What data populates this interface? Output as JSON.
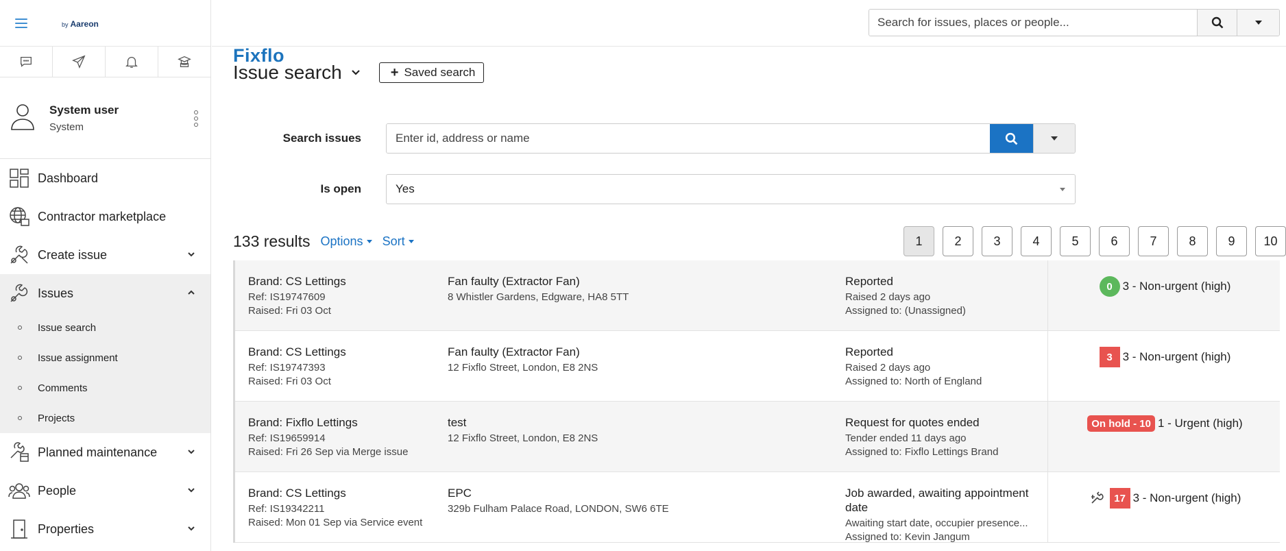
{
  "app": {
    "logo_text": "Fixflo",
    "logo_by": "by",
    "logo_company": "Aareon"
  },
  "colors": {
    "accent": "#1b73c4",
    "green_badge": "#5cb85c",
    "red_badge": "#e8534f"
  },
  "sidebar": {
    "icon_tabs": [
      {
        "icon": "chat-icon"
      },
      {
        "icon": "send-icon"
      },
      {
        "icon": "bell-icon"
      },
      {
        "icon": "graduation-icon"
      }
    ],
    "user": {
      "name": "System user",
      "role": "System"
    },
    "nav": [
      {
        "label": "Dashboard",
        "icon": "dashboard-icon"
      },
      {
        "label": "Contractor marketplace",
        "icon": "globe-icon"
      },
      {
        "label": "Create issue",
        "icon": "wrench-icon"
      },
      {
        "label": "Issues",
        "icon": "wrench-icon"
      },
      {
        "label": "Planned maintenance",
        "icon": "calendar-wrench-icon"
      },
      {
        "label": "People",
        "icon": "people-icon"
      },
      {
        "label": "Properties",
        "icon": "door-icon"
      }
    ],
    "issues_sub": [
      "Issue search",
      "Issue assignment",
      "Comments",
      "Projects"
    ]
  },
  "topbar": {
    "search_placeholder": "Search for issues, places or people..."
  },
  "page": {
    "title": "Issue search",
    "saved_search_label": "Saved search"
  },
  "form": {
    "search_label": "Search issues",
    "search_placeholder": "Enter id, address or name",
    "is_open_label": "Is open",
    "is_open_value": "Yes"
  },
  "results": {
    "count": "133 results",
    "options_label": "Options",
    "sort_label": "Sort",
    "pages": [
      "1",
      "2",
      "3",
      "4",
      "5",
      "6",
      "7",
      "8",
      "9",
      "10"
    ],
    "current_page": "1",
    "rows": [
      {
        "brand": "Brand: CS Lettings",
        "ref": "Ref: IS19747609",
        "raised": "Raised: Fri 03 Oct",
        "title": "Fan faulty (Extractor Fan)",
        "address": "8 Whistler Gardens, Edgware, HA8 5TT",
        "status": "Reported",
        "status_line": "Raised 2 days ago",
        "assigned": "Assigned to: (Unassigned)",
        "badge": "0",
        "badge_style": "circle",
        "badge_color": "#5cb85c",
        "priority": "3 - Non-urgent (high)"
      },
      {
        "brand": "Brand: CS Lettings",
        "ref": "Ref: IS19747393",
        "raised": "Raised: Fri 03 Oct",
        "title": "Fan faulty (Extractor Fan)",
        "address": "12 Fixflo Street, London, E8 2NS",
        "status": "Reported",
        "status_line": "Raised 2 days ago",
        "assigned": "Assigned to: North of England",
        "badge": "3",
        "badge_style": "square",
        "badge_color": "#e8534f",
        "priority": "3 - Non-urgent (high)"
      },
      {
        "brand": "Brand: Fixflo Lettings",
        "ref": "Ref: IS19659914",
        "raised": "Raised: Fri 26 Sep via Merge issue",
        "title": "test",
        "address": "12 Fixflo Street, London, E8 2NS",
        "status": "Request for quotes ended",
        "status_line": "Tender ended 11 days ago",
        "assigned": "Assigned to: Fixflo Lettings Brand",
        "badge": "On hold - 10",
        "badge_style": "pill",
        "badge_color": "#e8534f",
        "priority": "1 - Urgent (high)"
      },
      {
        "brand": "Brand: CS Lettings",
        "ref": "Ref: IS19342211",
        "raised": "Raised: Mon 01 Sep via Service event",
        "title": "EPC",
        "address": "329b Fulham Palace Road, LONDON, SW6 6TE",
        "status": "Job awarded, awaiting appointment date",
        "status_line": "Awaiting start date, occupier presence...",
        "assigned": "Assigned to: Kevin Jangum",
        "badge": "17",
        "badge_style": "square",
        "badge_color": "#e8534f",
        "priority": "3 - Non-urgent (high)",
        "extra_icon": "contractor-icon"
      }
    ]
  }
}
